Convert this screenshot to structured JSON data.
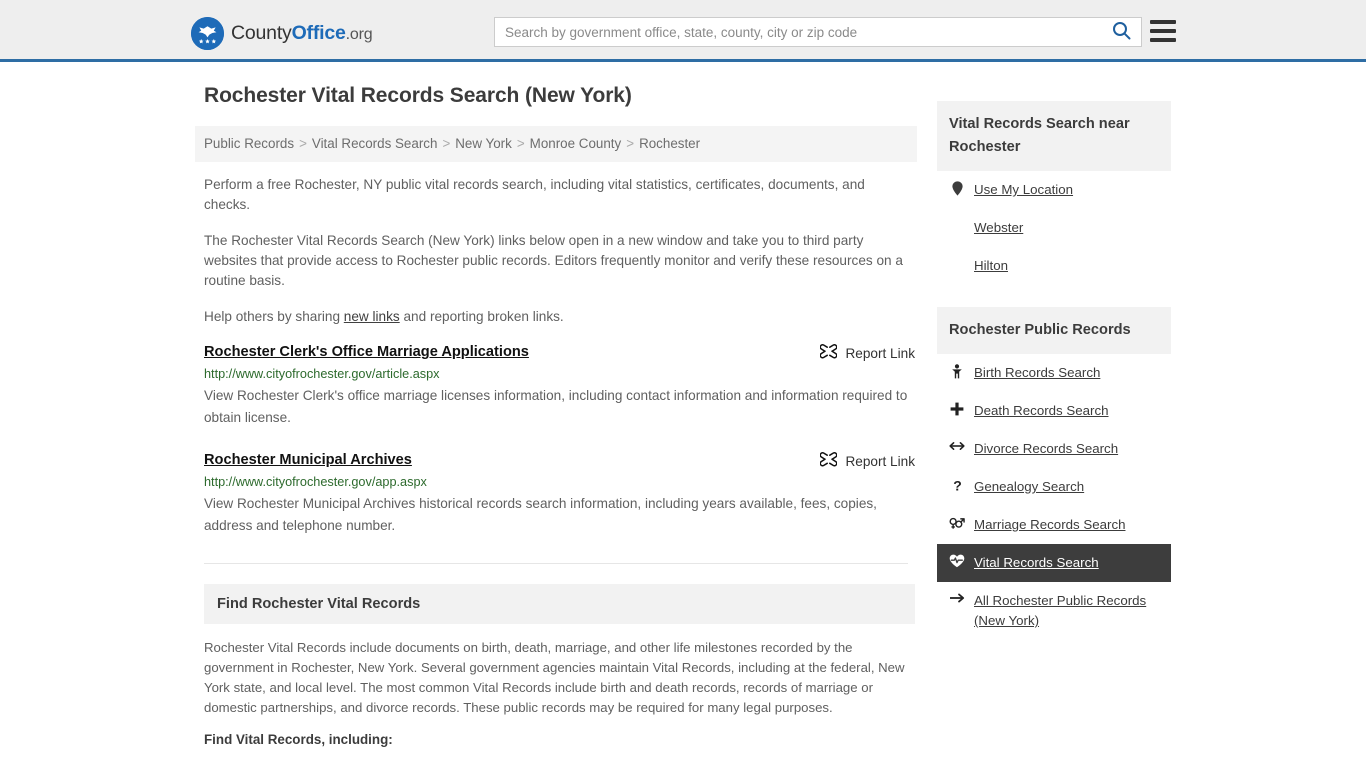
{
  "header": {
    "logo": {
      "icon": "eagle-seal-icon",
      "text_part1": "County",
      "text_part2": "Office",
      "text_part3": ".org"
    },
    "search": {
      "placeholder": "Search by government office, state, county, city or zip code",
      "value": "",
      "search_icon": "search-icon"
    },
    "menu_icon": "hamburger-menu-icon",
    "accent_color": "#2e6da4",
    "background_color": "#eeeeee"
  },
  "page": {
    "title": "Rochester Vital Records Search (New York)"
  },
  "breadcrumb": {
    "separator": ">",
    "items": [
      {
        "label": "Public Records"
      },
      {
        "label": "Vital Records Search"
      },
      {
        "label": "New York"
      },
      {
        "label": "Monroe County"
      },
      {
        "label": "Rochester"
      }
    ]
  },
  "intro": {
    "p1": "Perform a free Rochester, NY public vital records search, including vital statistics, certificates, documents, and checks.",
    "p2": "The Rochester Vital Records Search (New York) links below open in a new window and take you to third party websites that provide access to Rochester public records. Editors frequently monitor and verify these resources on a routine basis.",
    "p3_before": "Help others by sharing ",
    "p3_link": "new links",
    "p3_after": " and reporting broken links."
  },
  "results": [
    {
      "title": "Rochester Clerk's Office Marriage Applications",
      "url": "http://www.cityofrochester.gov/article.aspx",
      "description": "View Rochester Clerk's office marriage licenses information, including contact information and information required to obtain license.",
      "report_label": "Report Link",
      "report_icon": "broken-link-icon"
    },
    {
      "title": "Rochester Municipal Archives",
      "url": "http://www.cityofrochester.gov/app.aspx",
      "description": "View Rochester Municipal Archives historical records search information, including years available, fees, copies, address and telephone number.",
      "report_label": "Report Link",
      "report_icon": "broken-link-icon"
    }
  ],
  "find_section": {
    "heading": "Find Rochester Vital Records",
    "paragraph": "Rochester Vital Records include documents on birth, death, marriage, and other life milestones recorded by the government in Rochester, New York. Several government agencies maintain Vital Records, including at the federal, New York state, and local level. The most common Vital Records include birth and death records, records of marriage or domestic partnerships, and divorce records. These public records may be required for many legal purposes.",
    "list_intro": "Find Vital Records, including:"
  },
  "sidebar": {
    "nearby": {
      "heading": "Vital Records Search near Rochester",
      "items": [
        {
          "label": "Use My Location",
          "icon": "map-pin-icon"
        },
        {
          "label": "Webster",
          "icon": ""
        },
        {
          "label": "Hilton",
          "icon": ""
        }
      ]
    },
    "public_records": {
      "heading": "Rochester Public Records",
      "items": [
        {
          "label": "Birth Records Search",
          "icon": "baby-icon",
          "active": false
        },
        {
          "label": "Death Records Search",
          "icon": "cross-icon",
          "active": false
        },
        {
          "label": "Divorce Records Search",
          "icon": "left-right-arrow-icon",
          "active": false
        },
        {
          "label": "Genealogy Search",
          "icon": "question-mark-icon",
          "active": false
        },
        {
          "label": "Marriage Records Search",
          "icon": "gender-symbols-icon",
          "active": false
        },
        {
          "label": "Vital Records Search",
          "icon": "heartbeat-icon",
          "active": true
        },
        {
          "label": "All Rochester Public Records (New York)",
          "icon": "arrow-right-icon",
          "active": false
        }
      ],
      "active_background": "#3d3d3d"
    }
  }
}
